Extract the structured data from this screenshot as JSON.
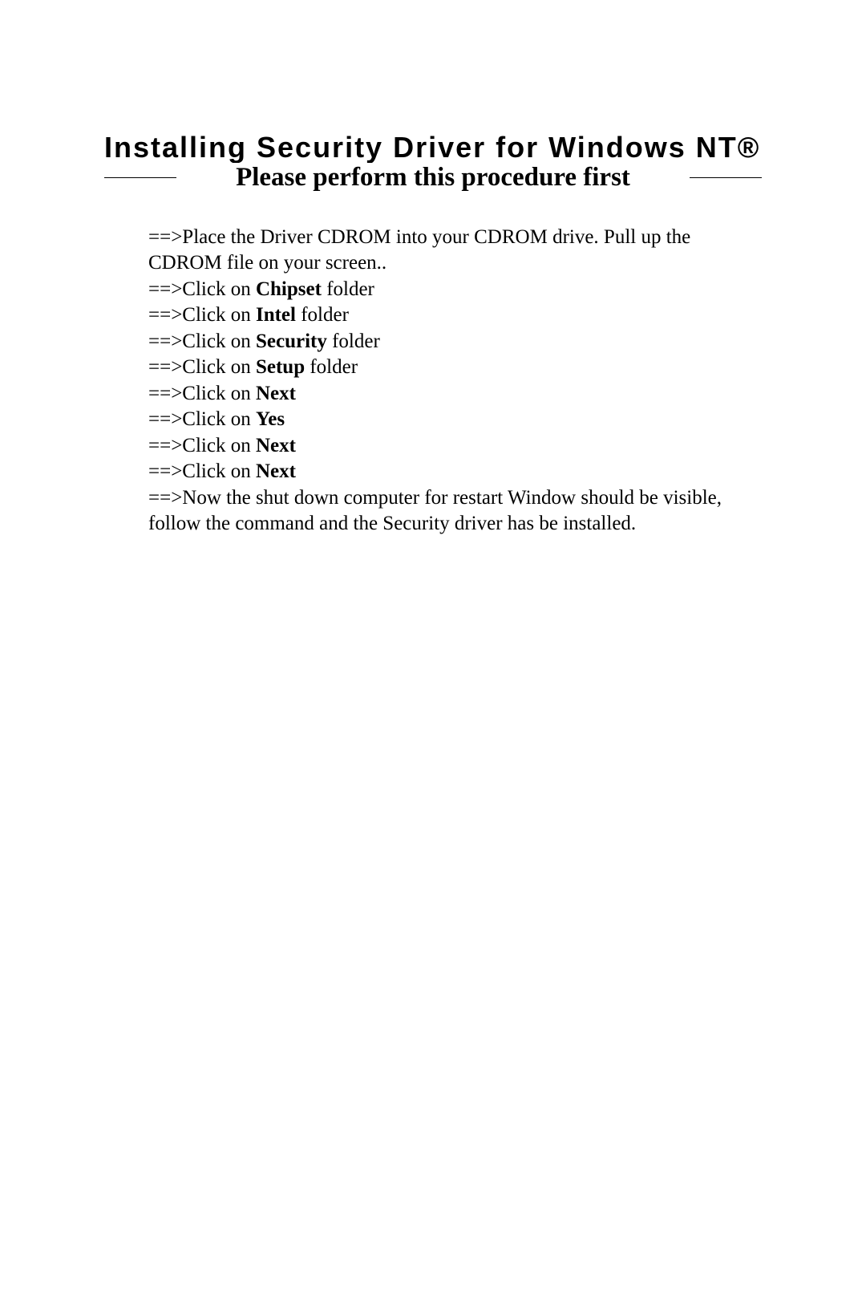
{
  "heading": "Installing Security Driver for Windows NT®",
  "subheading": "Please perform this procedure first",
  "steps": {
    "s0": "==>Place the Driver CDROM into your CDROM drive.  Pull up the CDROM file on your screen..",
    "s1_pre": "==>Click on ",
    "s1_bold": "Chipset",
    "s1_post": " folder",
    "s2_pre": "==>Click on ",
    "s2_bold": "Intel",
    "s2_post": " folder",
    "s3_pre": "==>Click on ",
    "s3_bold": "Security",
    "s3_post": " folder",
    "s4_pre": "==>Click on ",
    "s4_bold": "Setup",
    "s4_post": " folder",
    "s5_pre": "==>Click on ",
    "s5_bold": "Next",
    "s6_pre": "==>Click on ",
    "s6_bold": "Yes",
    "s7_pre": "==>Click on ",
    "s7_bold": "Next",
    "s8_pre": "==>Click on ",
    "s8_bold": "Next",
    "s9": "==>Now the shut down computer for restart Window should be visible, follow the command and the Security driver has be installed."
  }
}
